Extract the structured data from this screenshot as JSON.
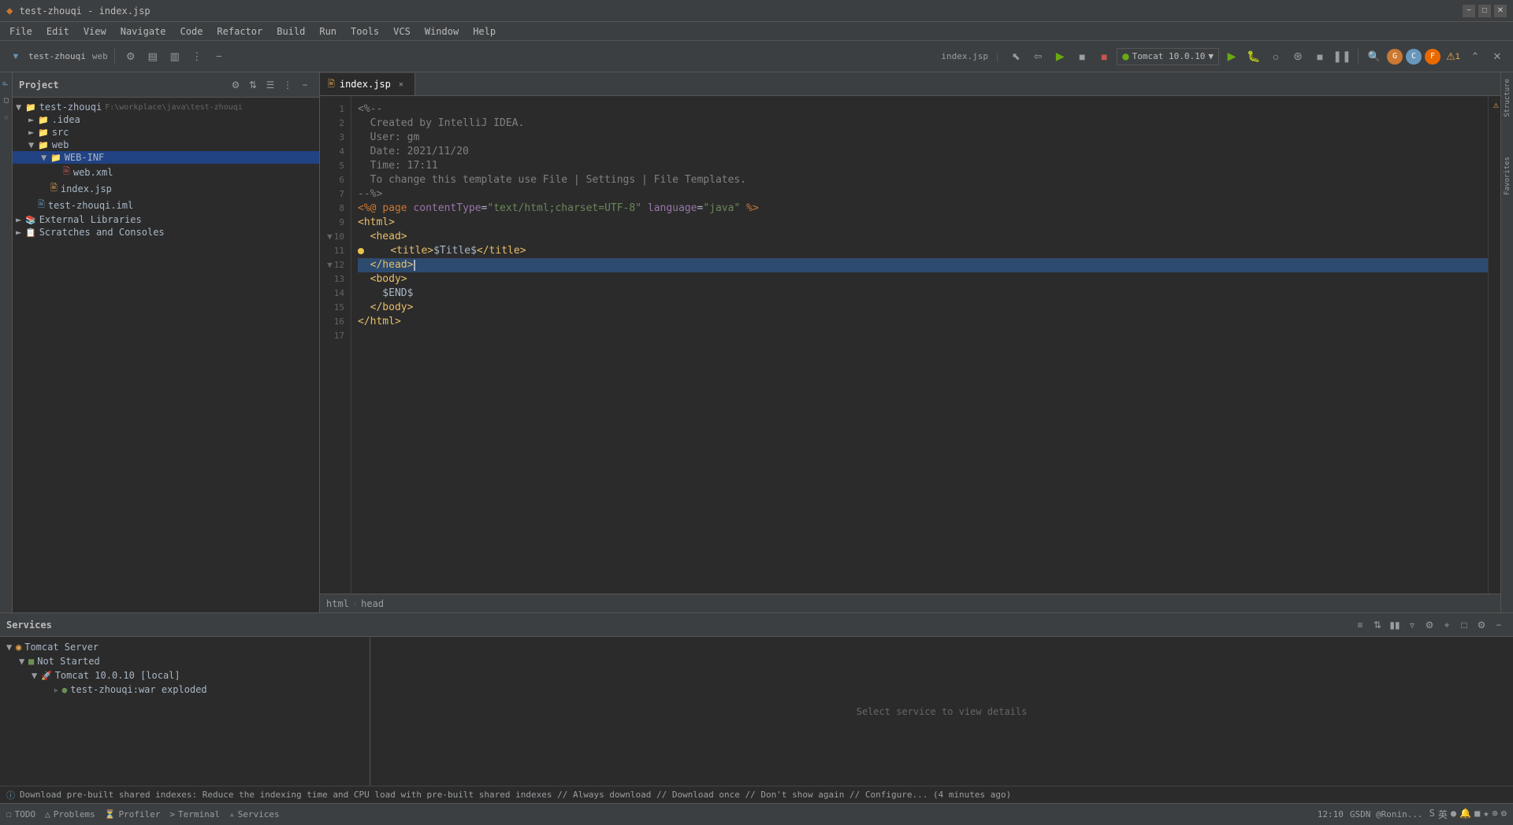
{
  "titleBar": {
    "title": "test-zhouqi - index.jsp",
    "windowControls": [
      "minimize",
      "maximize",
      "close"
    ]
  },
  "menuBar": {
    "items": [
      "File",
      "Edit",
      "View",
      "Navigate",
      "Code",
      "Refactor",
      "Build",
      "Run",
      "Tools",
      "VCS",
      "Window",
      "Help"
    ]
  },
  "toolbar": {
    "projectLabel": "test-zhouqi",
    "branchLabel": "web",
    "tabLabel": "index.jsp",
    "runConfig": "Tomcat 10.0.10",
    "warningCount": "1"
  },
  "projectPanel": {
    "title": "Project",
    "items": [
      {
        "id": "test-zhouqi",
        "label": "test-zhouqi",
        "path": "F:\\workplace\\java\\test-zhouqi",
        "type": "root",
        "indent": 0,
        "expanded": true
      },
      {
        "id": "idea",
        "label": ".idea",
        "type": "folder",
        "indent": 1,
        "expanded": false
      },
      {
        "id": "src",
        "label": "src",
        "type": "folder",
        "indent": 1,
        "expanded": false
      },
      {
        "id": "web",
        "label": "web",
        "type": "folder",
        "indent": 1,
        "expanded": true
      },
      {
        "id": "web-inf",
        "label": "WEB-INF",
        "type": "folder",
        "indent": 2,
        "expanded": true,
        "selected": true
      },
      {
        "id": "web-xml",
        "label": "web.xml",
        "type": "xml",
        "indent": 3,
        "expanded": false
      },
      {
        "id": "index-jsp",
        "label": "index.jsp",
        "type": "jsp",
        "indent": 2,
        "expanded": false
      },
      {
        "id": "test-zhouqi-iml",
        "label": "test-zhouqi.iml",
        "type": "iml",
        "indent": 1,
        "expanded": false
      },
      {
        "id": "external-libs",
        "label": "External Libraries",
        "type": "folder",
        "indent": 0,
        "expanded": false
      },
      {
        "id": "scratches",
        "label": "Scratches and Consoles",
        "type": "scratches",
        "indent": 0,
        "expanded": false
      }
    ]
  },
  "editor": {
    "tab": "index.jsp",
    "breadcrumb": [
      "html",
      "head"
    ],
    "lines": [
      {
        "num": 1,
        "content": "<%--",
        "type": "comment"
      },
      {
        "num": 2,
        "content": "  Created by IntelliJ IDEA.",
        "type": "comment"
      },
      {
        "num": 3,
        "content": "  User: gm",
        "type": "comment"
      },
      {
        "num": 4,
        "content": "  Date: 2021/11/20",
        "type": "comment"
      },
      {
        "num": 5,
        "content": "  Time: 17:11",
        "type": "comment"
      },
      {
        "num": 6,
        "content": "  To change this template use File | Settings | File Templates.",
        "type": "comment"
      },
      {
        "num": 7,
        "content": "--%>",
        "type": "comment"
      },
      {
        "num": 8,
        "content": "<%@ page contentType=\"text/html;charset=UTF-8\" language=\"java\" %>",
        "type": "directive"
      },
      {
        "num": 9,
        "content": "<html>",
        "type": "tag"
      },
      {
        "num": 10,
        "content": "  <head>",
        "type": "tag",
        "foldable": true
      },
      {
        "num": 11,
        "content": "    <title>$Title$</title>",
        "type": "tag",
        "hasWarning": true
      },
      {
        "num": 12,
        "content": "  </head>",
        "type": "tag",
        "foldable": true,
        "cursor": true
      },
      {
        "num": 13,
        "content": "  <body>",
        "type": "tag"
      },
      {
        "num": 14,
        "content": "    $END$",
        "type": "normal"
      },
      {
        "num": 15,
        "content": "  </body>",
        "type": "tag"
      },
      {
        "num": 16,
        "content": "</html>",
        "type": "tag"
      },
      {
        "num": 17,
        "content": "",
        "type": "empty"
      }
    ]
  },
  "servicesPanel": {
    "title": "Services",
    "noSelectionText": "Select service to view details",
    "tree": [
      {
        "id": "tomcat-server",
        "label": "Tomcat Server",
        "indent": 0,
        "expanded": true,
        "type": "server"
      },
      {
        "id": "not-started",
        "label": "Not Started",
        "indent": 1,
        "expanded": true,
        "type": "status",
        "status": "not-started"
      },
      {
        "id": "tomcat-local",
        "label": "Tomcat 10.0.10 [local]",
        "indent": 2,
        "expanded": true,
        "type": "tomcat"
      },
      {
        "id": "war-exploded",
        "label": "test-zhouqi:war exploded",
        "indent": 3,
        "expanded": false,
        "type": "artifact"
      }
    ]
  },
  "statusBar": {
    "todo": "TODO",
    "problems": "Problems",
    "profiler": "Profiler",
    "terminal": "Terminal",
    "services": "Services",
    "notification": "Download pre-built shared indexes: Reduce the indexing time and CPU load with pre-built shared indexes // Always download // Download once // Don't show again // Configure... (4 minutes ago)",
    "time": "12:10",
    "rightInfo": "GSDN @Ronin..."
  }
}
